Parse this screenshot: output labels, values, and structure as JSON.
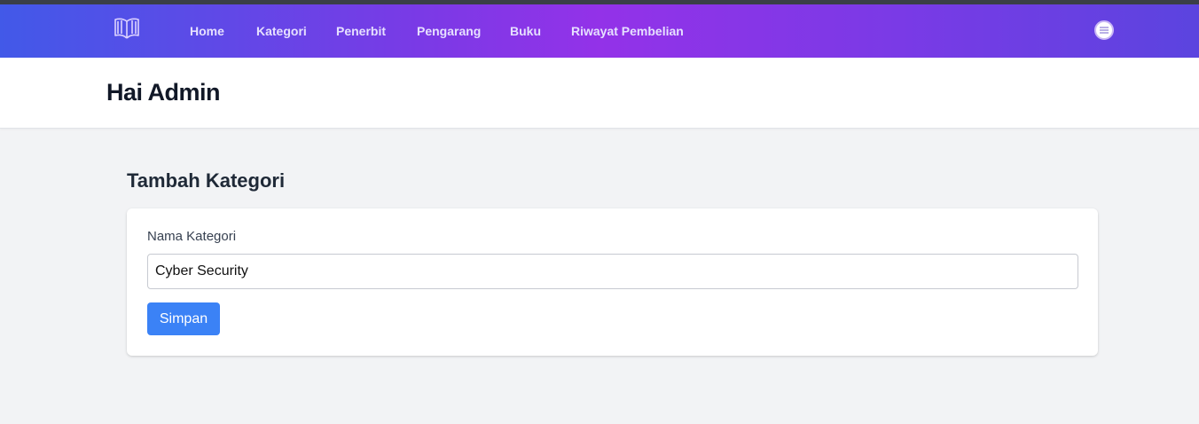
{
  "nav": {
    "logo_icon": "open-book-icon",
    "links": [
      {
        "label": "Home"
      },
      {
        "label": "Kategori"
      },
      {
        "label": "Penerbit"
      },
      {
        "label": "Pengarang"
      },
      {
        "label": "Buku"
      },
      {
        "label": "Riwayat Pembelian"
      }
    ],
    "menu_icon": "hamburger-menu-icon"
  },
  "header": {
    "title": "Hai Admin"
  },
  "form": {
    "title": "Tambah Kategori",
    "field_label": "Nama Kategori",
    "field_value": "Cyber Security",
    "submit_label": "Simpan"
  },
  "colors": {
    "nav_gradient_start": "#4259e8",
    "nav_gradient_mid": "#9332e8",
    "nav_gradient_end": "#5b44df",
    "primary_button": "#3b82f6",
    "page_background": "#f2f3f5"
  }
}
